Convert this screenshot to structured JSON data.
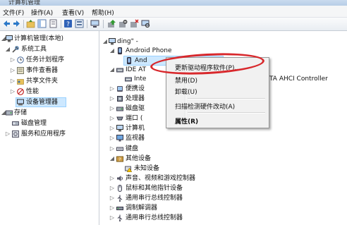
{
  "window": {
    "title": "计算机管理"
  },
  "menu": [
    "文件(F)",
    "操作(A)",
    "查看(V)",
    "帮助(H)"
  ],
  "left_tree": [
    {
      "label": "计算机管理(本地)",
      "icon": "computer-manage-icon",
      "expander": "down"
    },
    {
      "label": "系统工具",
      "icon": "tools-icon",
      "expander": "down"
    },
    {
      "label": "任务计划程序",
      "icon": "clock-icon",
      "expander": "right"
    },
    {
      "label": "事件查看器",
      "icon": "event-viewer-icon",
      "expander": "right"
    },
    {
      "label": "共享文件夹",
      "icon": "shared-folder-icon",
      "expander": "right"
    },
    {
      "label": "性能",
      "icon": "performance-icon",
      "expander": "right"
    },
    {
      "label": "设备管理器",
      "icon": "device-manager-icon",
      "expander": "none",
      "selected": true
    },
    {
      "label": "存储",
      "icon": "storage-icon",
      "expander": "down"
    },
    {
      "label": "磁盘管理",
      "icon": "disk-icon",
      "expander": "none"
    },
    {
      "label": "服务和应用程序",
      "icon": "services-icon",
      "expander": "right"
    }
  ],
  "device_tree": [
    {
      "label": "ding\"  -",
      "icon": "computer-icon",
      "expander": "down"
    },
    {
      "label": "Android Phone",
      "icon": "phone-icon",
      "expander": "down"
    },
    {
      "label": "And",
      "icon": "phone-device-icon",
      "expander": "none",
      "selected": true
    },
    {
      "label": "IDE AT",
      "icon": "ide-icon",
      "expander": "down"
    },
    {
      "label": "Inte",
      "icon": "controller-icon",
      "expander": "none",
      "tail": "TA AHCI Controller"
    },
    {
      "label": "便携设",
      "icon": "portable-device-icon",
      "expander": "right"
    },
    {
      "label": "处理器",
      "icon": "cpu-icon",
      "expander": "right"
    },
    {
      "label": "磁盘驱",
      "icon": "disk-drive-icon",
      "expander": "right"
    },
    {
      "label": "端口 (",
      "icon": "port-icon",
      "expander": "right"
    },
    {
      "label": "计算机",
      "icon": "computer-icon",
      "expander": "right"
    },
    {
      "label": "监视器",
      "icon": "monitor-icon",
      "expander": "right"
    },
    {
      "label": "键盘",
      "icon": "keyboard-icon",
      "expander": "right"
    },
    {
      "label": "其他设备",
      "icon": "other-devices-icon",
      "expander": "down"
    },
    {
      "label": "未知设备",
      "icon": "unknown-device-warning-icon",
      "expander": "none"
    },
    {
      "label": "声音、视频和游戏控制器",
      "icon": "sound-icon",
      "expander": "right"
    },
    {
      "label": "鼠标和其他指针设备",
      "icon": "mouse-icon",
      "expander": "right"
    },
    {
      "label": "通用串行总线控制器",
      "icon": "usb-icon",
      "expander": "right"
    },
    {
      "label": "调制解调器",
      "icon": "modem-icon",
      "expander": "right"
    },
    {
      "label": "通用串行总线控制器",
      "icon": "usb-icon",
      "expander": "right"
    }
  ],
  "context_menu": {
    "items": [
      "更新驱动程序软件(P)...",
      "禁用(D)",
      "卸载(U)",
      "扫描检测硬件改动(A)",
      "属性(R)"
    ]
  },
  "colors": {
    "highlight_oval": "#d8282c",
    "selection": "#cde8ff"
  }
}
